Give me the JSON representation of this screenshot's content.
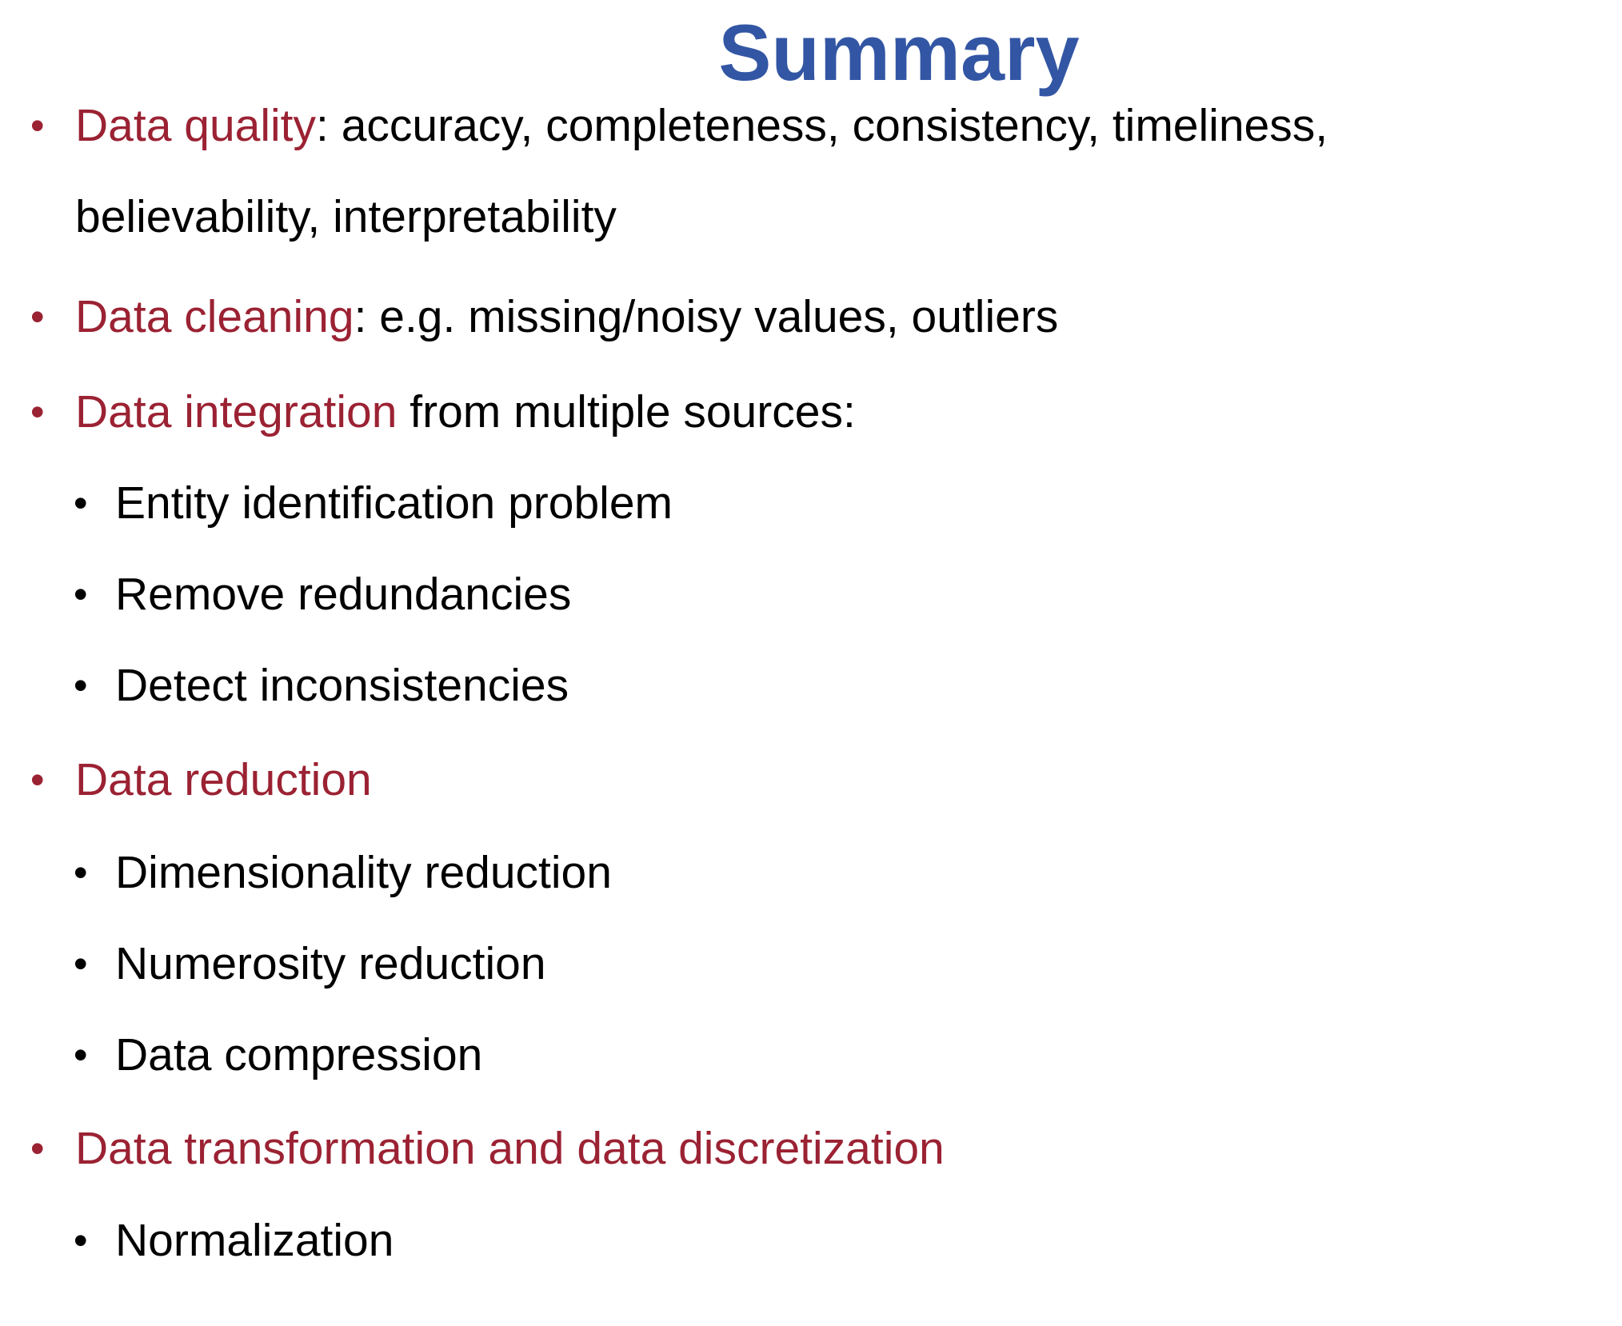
{
  "title": "Summary",
  "accent_color": "#9b2233",
  "title_color": "#3356a4",
  "items": [
    {
      "highlight": "Data quality",
      "text": ": accuracy, completeness, consistency, timeliness,",
      "continuation": "believability, interpretability"
    },
    {
      "highlight": "Data cleaning",
      "text": ": e.g. missing/noisy values, outliers"
    },
    {
      "highlight": "Data integration",
      "text": " from multiple sources:",
      "subitems": [
        "Entity identification problem",
        "Remove redundancies",
        "Detect inconsistencies"
      ]
    },
    {
      "highlight": "Data reduction",
      "text": "",
      "subitems": [
        "Dimensionality reduction",
        "Numerosity reduction",
        "Data compression"
      ]
    },
    {
      "highlight": "Data transformation and data discretization",
      "text": "",
      "subitems": [
        "Normalization"
      ]
    }
  ]
}
